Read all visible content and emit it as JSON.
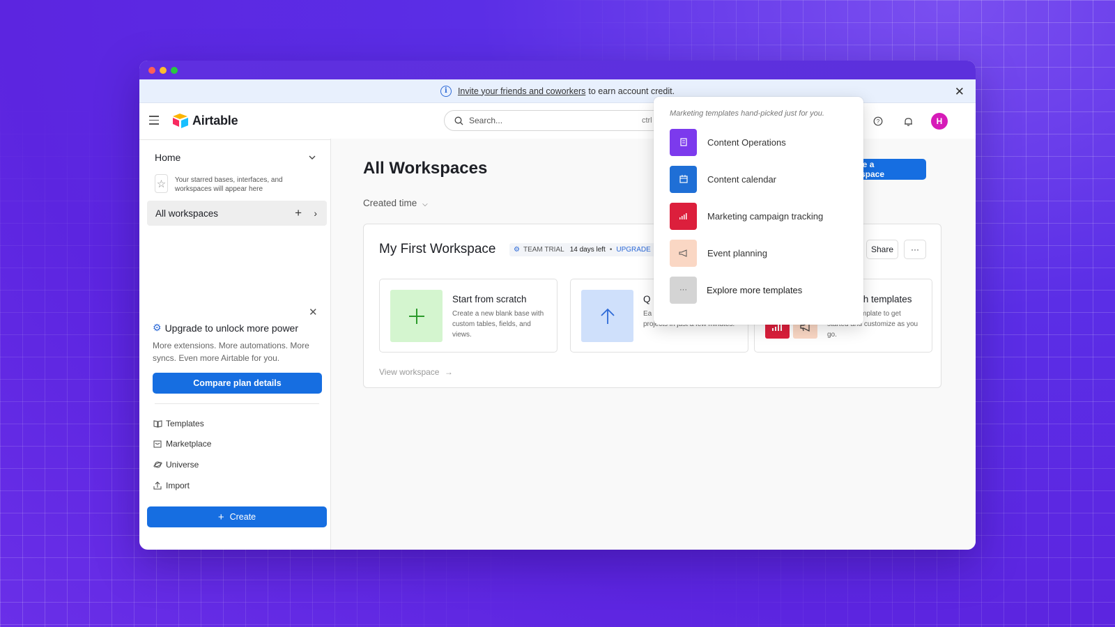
{
  "banner": {
    "link_text": "Invite your friends and coworkers",
    "rest_text": "to earn account credit."
  },
  "topbar": {
    "brand": "Airtable",
    "search_placeholder": "Search...",
    "search_shortcut": "ctrl K",
    "avatar_initial": "H"
  },
  "sidebar": {
    "home_label": "Home",
    "starred_note": "Your starred bases, interfaces, and workspaces will appear here",
    "all_workspaces_label": "All workspaces",
    "upgrade": {
      "title": "Upgrade to unlock more power",
      "description": "More extensions. More automations. More syncs. Even more Airtable for you.",
      "button_label": "Compare plan details"
    },
    "links": [
      {
        "label": "Templates",
        "icon": "book-icon"
      },
      {
        "label": "Marketplace",
        "icon": "marketplace-icon"
      },
      {
        "label": "Universe",
        "icon": "globe-icon"
      },
      {
        "label": "Import",
        "icon": "upload-icon"
      }
    ],
    "create_label": "Create"
  },
  "main": {
    "title": "All Workspaces",
    "sort_label": "Created time",
    "create_workspace_label": "Create a workspace",
    "workspace": {
      "name": "My First Workspace",
      "plan_badge": "TEAM TRIAL",
      "days_left": "14 days left",
      "upgrade_label": "UPGRADE",
      "share_label": "Share",
      "more_label": "···",
      "view_label": "View workspace"
    },
    "options": [
      {
        "title": "Start from scratch",
        "description": "Create a new blank base with custom tables, fields, and views."
      },
      {
        "title": "Q",
        "description_part": "Ea",
        "description": "projects in just a few minutes."
      },
      {
        "title": "th templates",
        "description_part": "mplate to get",
        "description": "started and customize as you go."
      }
    ]
  },
  "popover": {
    "heading": "Marketing templates hand-picked just for you.",
    "items": [
      {
        "label": "Content Operations",
        "icon": "document-icon",
        "color": "#7c3aed"
      },
      {
        "label": "Content calendar",
        "icon": "calendar-icon",
        "color": "#1f6fd6"
      },
      {
        "label": "Marketing campaign tracking",
        "icon": "bar-chart-icon",
        "color": "#dc1f3c"
      },
      {
        "label": "Event planning",
        "icon": "megaphone-icon",
        "color": "#fad7c4"
      },
      {
        "label": "Explore more templates",
        "icon": "ellipsis-icon",
        "color": "#d4d4d4"
      }
    ]
  },
  "colors": {
    "accent": "#166ee1",
    "background": "#5b2ee6",
    "avatar": "#d61bb8"
  }
}
